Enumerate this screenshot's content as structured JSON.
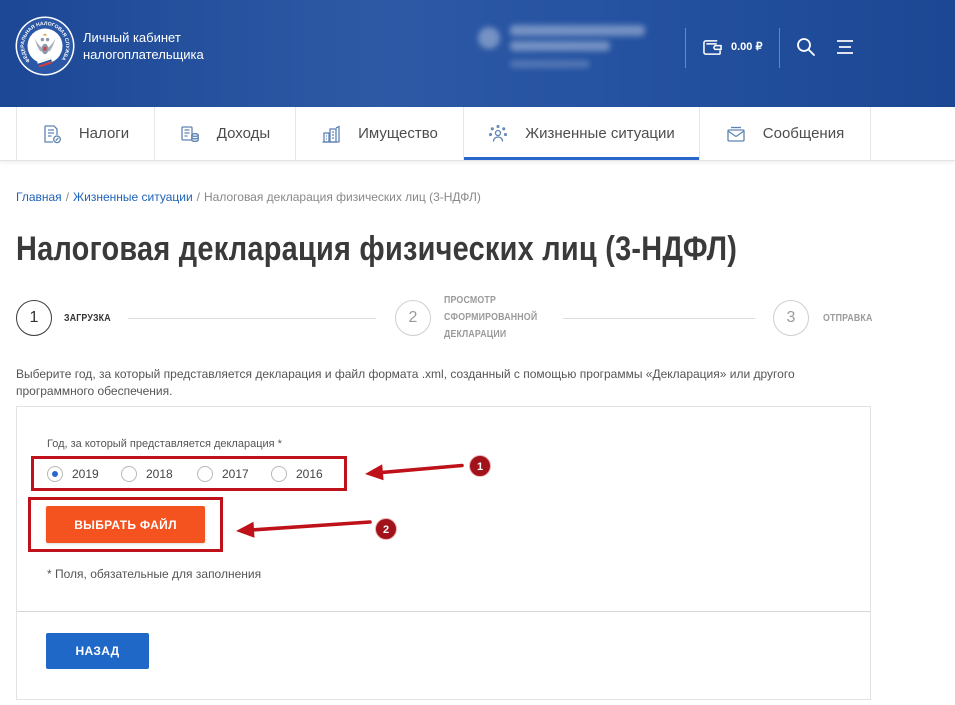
{
  "header": {
    "logo_text": "ФЕДЕРАЛЬНАЯ НАЛОГОВАЯ СЛУЖБА",
    "title_line1": "Личный кабинет",
    "title_line2": "налогоплательщика",
    "balance": "0.00 ₽",
    "wallet_icon": "wallet-icon",
    "search_icon": "search-icon",
    "menu_icon": "hamburger-menu-icon"
  },
  "nav": {
    "tabs": [
      {
        "label": "Налоги",
        "icon": "tax-document-icon",
        "active": false
      },
      {
        "label": "Доходы",
        "icon": "income-coins-icon",
        "active": false
      },
      {
        "label": "Имущество",
        "icon": "property-buildings-icon",
        "active": false
      },
      {
        "label": "Жизненные ситуации",
        "icon": "life-situations-icon",
        "active": true
      },
      {
        "label": "Сообщения",
        "icon": "messages-envelope-icon",
        "active": false
      }
    ]
  },
  "breadcrumb": {
    "separator": "/",
    "items": [
      {
        "label": "Главная",
        "link": true
      },
      {
        "label": "Жизненные ситуации",
        "link": true
      },
      {
        "label": "Налоговая декларация физических лиц (3-НДФЛ)",
        "link": false
      }
    ]
  },
  "page_title": "Налоговая декларация физических лиц (3-НДФЛ)",
  "stepper": {
    "steps": [
      {
        "number": "1",
        "label_lines": [
          "ЗАГРУЗКА"
        ],
        "active": true
      },
      {
        "number": "2",
        "label_lines": [
          "ПРОСМОТР",
          "СФОРМИРОВАННОЙ",
          "ДЕКЛАРАЦИИ"
        ],
        "active": false
      },
      {
        "number": "3",
        "label_lines": [
          "ОТПРАВКА"
        ],
        "active": false
      }
    ]
  },
  "description_lines": [
    "Выберите год, за который представляется декларация и файл формата .xml, созданный с помощью программы «Декларация» или другого",
    "программного обеспечения."
  ],
  "form": {
    "year_label": "Год, за который представляется декларация *",
    "year_options": [
      {
        "label": "2019",
        "checked": true
      },
      {
        "label": "2018",
        "checked": false
      },
      {
        "label": "2017",
        "checked": false
      },
      {
        "label": "2016",
        "checked": false
      }
    ],
    "choose_file_button": "ВЫБРАТЬ ФАЙЛ",
    "required_note": "* Поля, обязательные для заполнения",
    "back_button": "НАЗАД"
  },
  "annotations": [
    {
      "badge": "1"
    },
    {
      "badge": "2"
    }
  ],
  "colors": {
    "header_bg": "#1d4c9e",
    "accent": "#2a67cc",
    "primary_button": "#2068c8",
    "orange_button": "#f4521f",
    "annotation_red": "#bf1119",
    "link": "#1f63b8"
  }
}
